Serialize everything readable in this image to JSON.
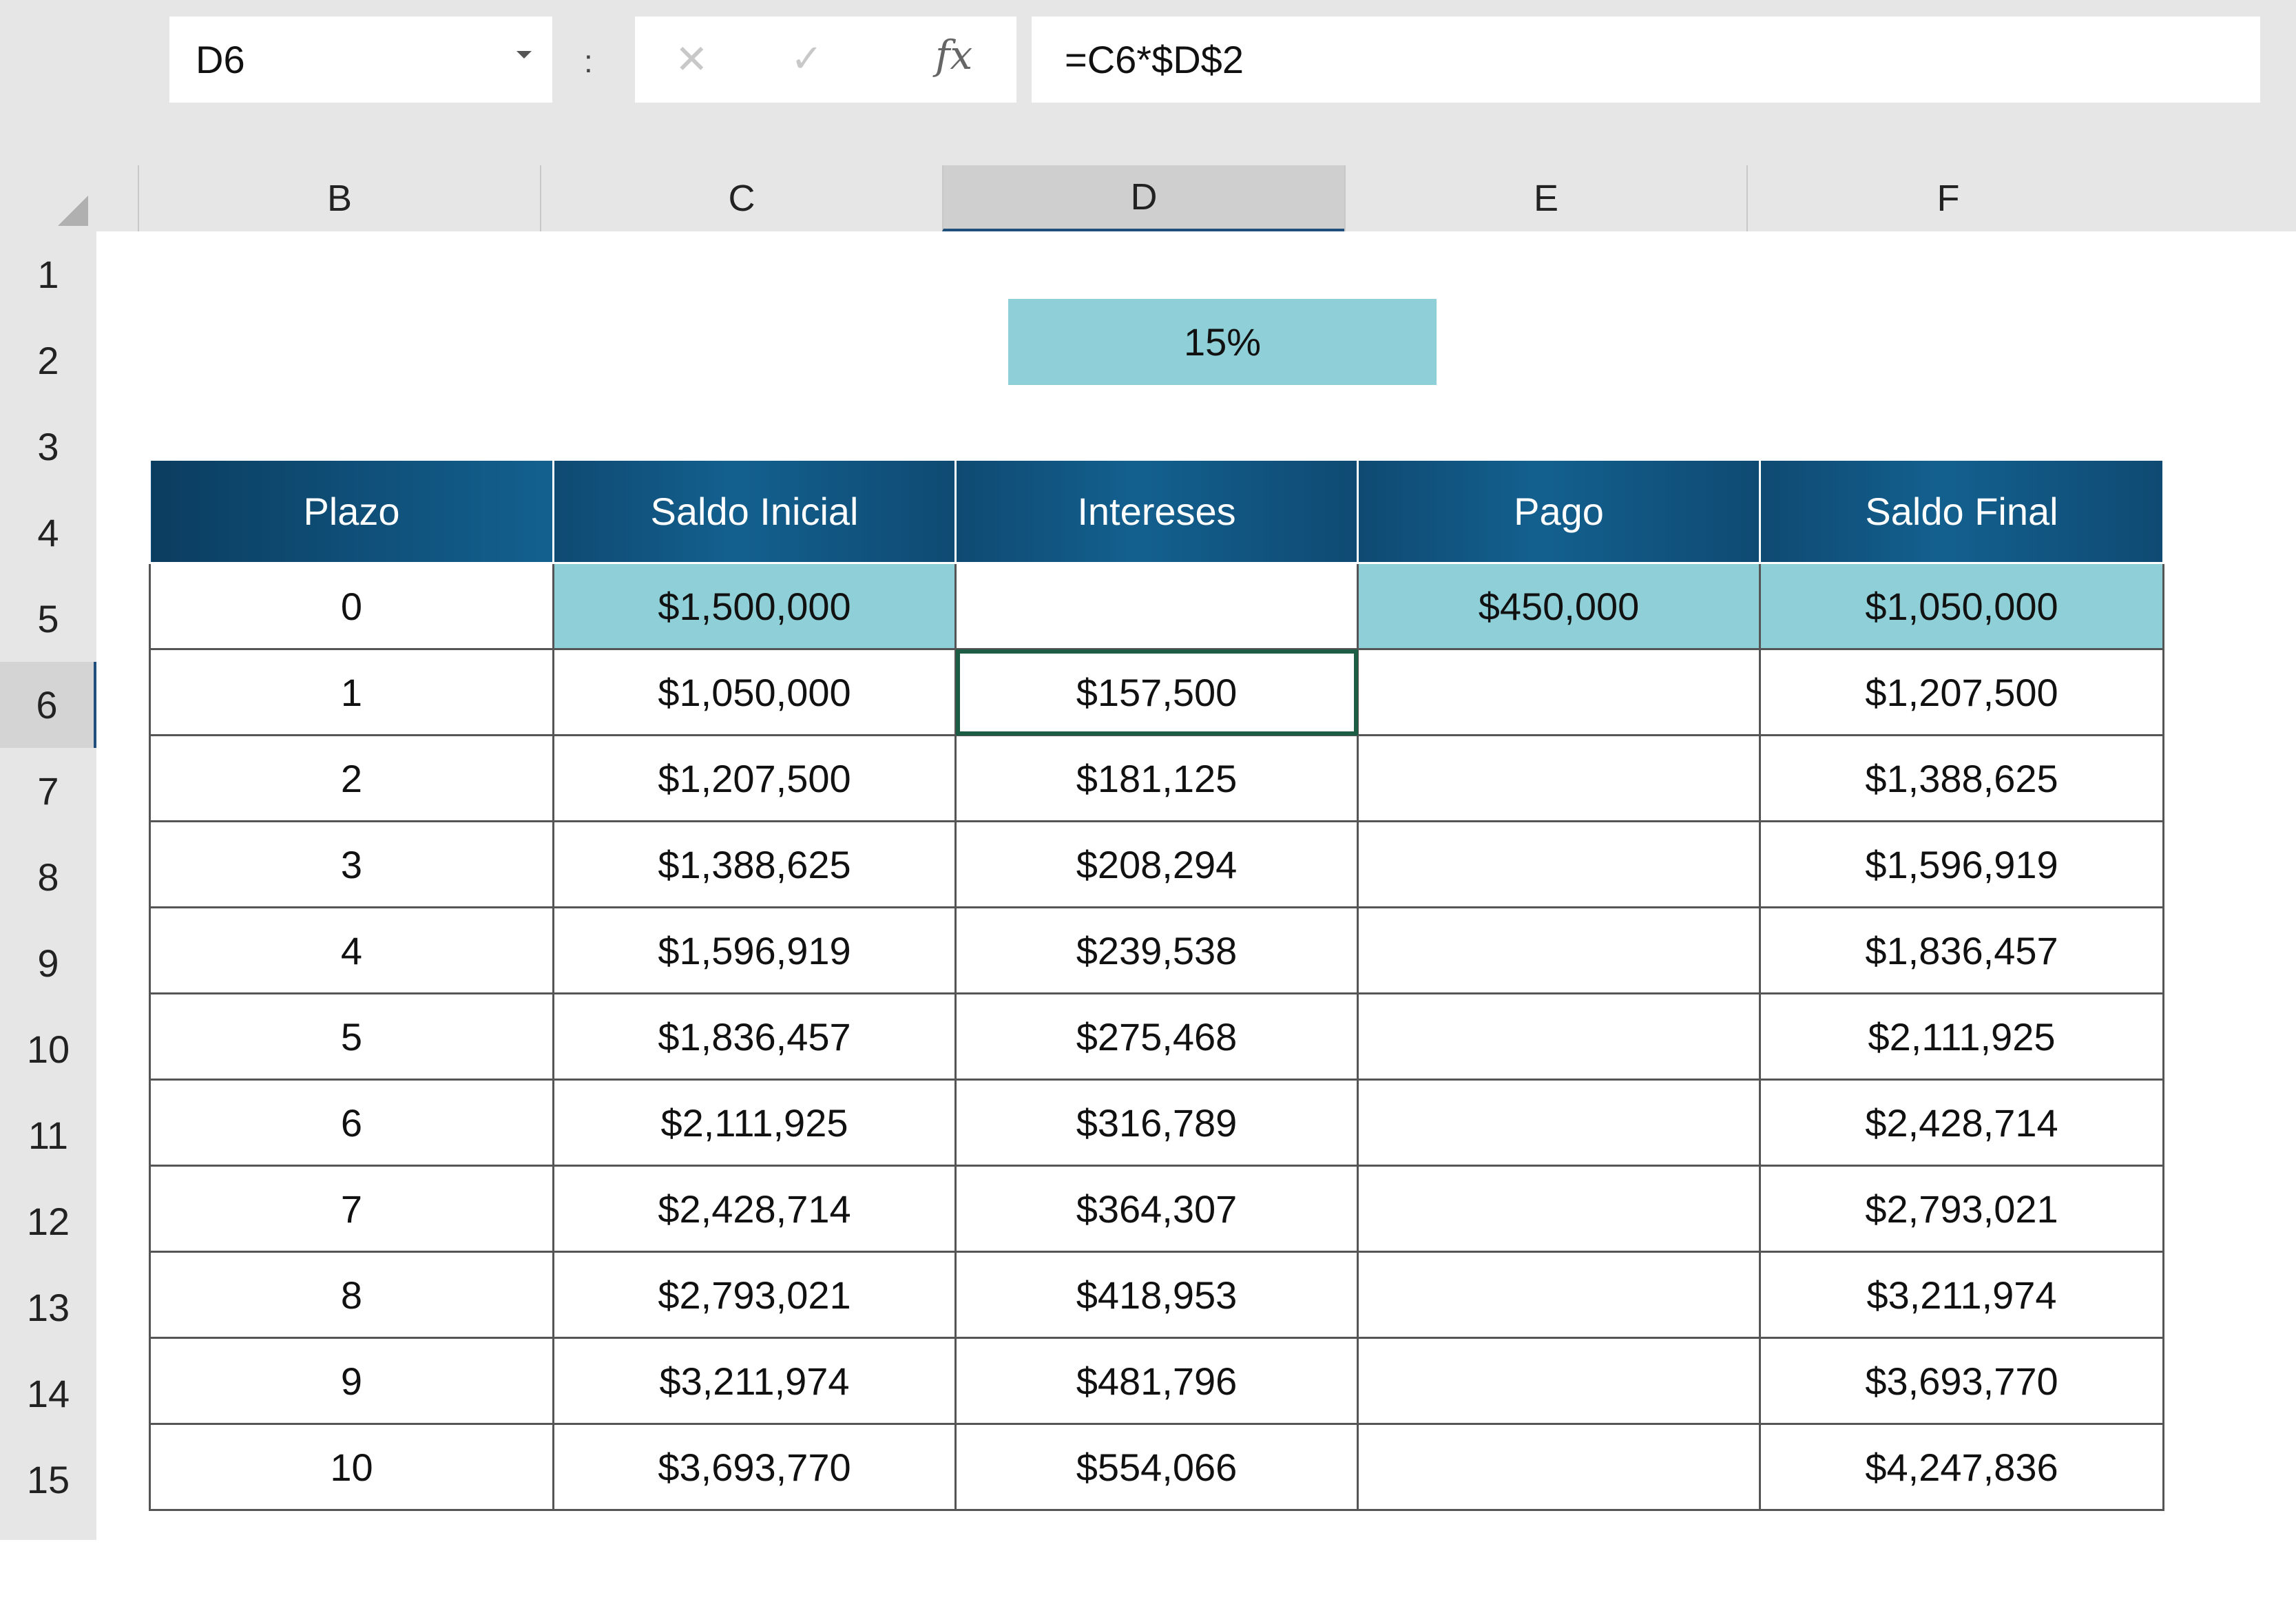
{
  "name_box": {
    "value": "D6"
  },
  "formula_bar": {
    "colon": ":",
    "cancel_icon": "✕",
    "enter_icon": "✓",
    "fx_label": "fx",
    "formula": "=C6*$D$2"
  },
  "columns": [
    "B",
    "C",
    "D",
    "E",
    "F"
  ],
  "active_column": "D",
  "rows": [
    "1",
    "2",
    "3",
    "4",
    "5",
    "6",
    "7",
    "8",
    "9",
    "10",
    "11",
    "12",
    "13",
    "14",
    "15"
  ],
  "active_row": "6",
  "rate_cell": {
    "value": "15%"
  },
  "table": {
    "headers": [
      "Plazo",
      "Saldo Inicial",
      "Intereses",
      "Pago",
      "Saldo Final"
    ],
    "rows": [
      [
        "0",
        "$1,500,000",
        "",
        "$450,000",
        "$1,050,000"
      ],
      [
        "1",
        "$1,050,000",
        "$157,500",
        "",
        "$1,207,500"
      ],
      [
        "2",
        "$1,207,500",
        "$181,125",
        "",
        "$1,388,625"
      ],
      [
        "3",
        "$1,388,625",
        "$208,294",
        "",
        "$1,596,919"
      ],
      [
        "4",
        "$1,596,919",
        "$239,538",
        "",
        "$1,836,457"
      ],
      [
        "5",
        "$1,836,457",
        "$275,468",
        "",
        "$2,111,925"
      ],
      [
        "6",
        "$2,111,925",
        "$316,789",
        "",
        "$2,428,714"
      ],
      [
        "7",
        "$2,428,714",
        "$364,307",
        "",
        "$2,793,021"
      ],
      [
        "8",
        "$2,793,021",
        "$418,953",
        "",
        "$3,211,974"
      ],
      [
        "9",
        "$3,211,974",
        "$481,796",
        "",
        "$3,693,770"
      ],
      [
        "10",
        "$3,693,770",
        "$554,066",
        "",
        "$4,247,836"
      ]
    ]
  },
  "colors": {
    "header_blue": "#13608f",
    "highlight_teal": "#8fcfd7",
    "selection_green": "#1d5c45"
  }
}
